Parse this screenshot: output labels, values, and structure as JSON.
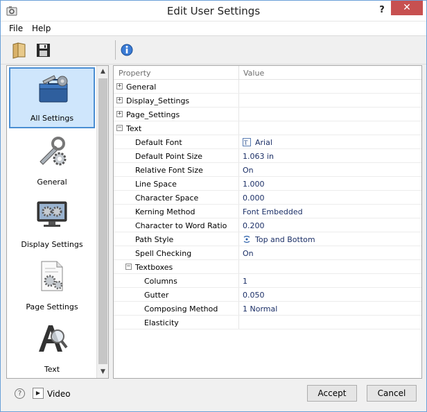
{
  "window": {
    "title": "Edit User Settings",
    "help_glyph": "?",
    "close_glyph": "✕"
  },
  "menu": {
    "file": "File",
    "help": "Help"
  },
  "toolbar": {
    "open_icon": "folder-icon",
    "save_icon": "save-icon",
    "info_icon": "info-icon"
  },
  "categories": [
    {
      "label": "All Settings",
      "icon": "toolbox-icon",
      "selected": true
    },
    {
      "label": "General",
      "icon": "wrench-gear-icon"
    },
    {
      "label": "Display Settings",
      "icon": "monitor-gear-icon"
    },
    {
      "label": "Page Settings",
      "icon": "page-gear-icon"
    },
    {
      "label": "Text",
      "icon": "text-magnifier-icon"
    }
  ],
  "grid": {
    "col_property": "Property",
    "col_value": "Value",
    "rows": [
      {
        "name": "General",
        "value": "",
        "expander": "+"
      },
      {
        "name": "Display_Settings",
        "value": "",
        "expander": "+"
      },
      {
        "name": "Page_Settings",
        "value": "",
        "expander": "+"
      },
      {
        "name": "Text",
        "value": "",
        "expander": "−"
      },
      {
        "name": "Default Font",
        "value": "Arial"
      },
      {
        "name": "Default Point Size",
        "value": "1.063 in"
      },
      {
        "name": "Relative Font Size",
        "value": "On"
      },
      {
        "name": "Line Space",
        "value": "1.000"
      },
      {
        "name": "Character Space",
        "value": "0.000"
      },
      {
        "name": "Kerning Method",
        "value": "Font Embedded"
      },
      {
        "name": "Character to Word Ratio",
        "value": "0.200"
      },
      {
        "name": "Path Style",
        "value": "Top and Bottom"
      },
      {
        "name": "Spell Checking",
        "value": "On"
      },
      {
        "name": "Textboxes",
        "value": "",
        "expander": "−"
      },
      {
        "name": "Columns",
        "value": "1"
      },
      {
        "name": "Gutter",
        "value": "0.050"
      },
      {
        "name": "Composing Method",
        "value": "1 Normal"
      },
      {
        "name": "Elasticity",
        "value": ""
      }
    ]
  },
  "bottom": {
    "help_glyph": "?",
    "video_glyph": "▶",
    "video_label": "Video",
    "accept": "Accept",
    "cancel": "Cancel"
  },
  "colors": {
    "selection": "#cfe6fc",
    "selection_border": "#4a8ed3",
    "close_button": "#c75050",
    "value_text": "#1a2e66"
  }
}
